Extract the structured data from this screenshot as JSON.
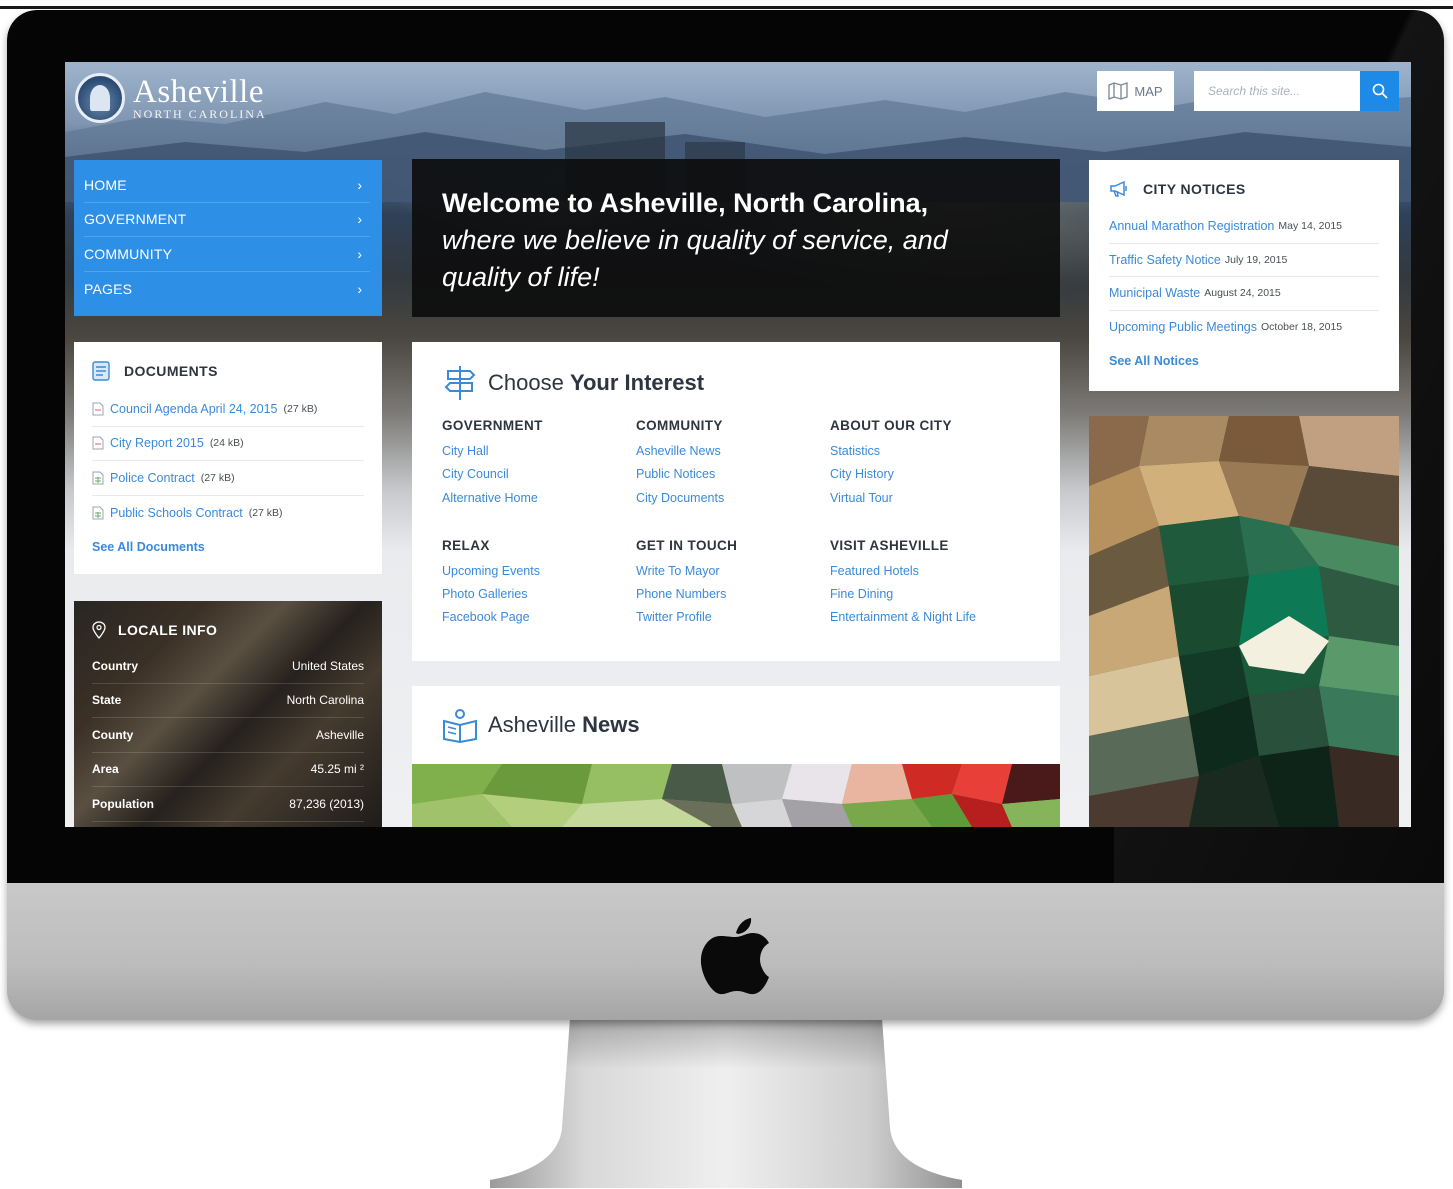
{
  "site": {
    "name": "Asheville",
    "subtitle": "NORTH CAROLINA"
  },
  "header": {
    "map_label": "MAP",
    "search_placeholder": "Search this site..."
  },
  "nav": {
    "items": [
      {
        "label": "HOME"
      },
      {
        "label": "GOVERNMENT"
      },
      {
        "label": "COMMUNITY"
      },
      {
        "label": "PAGES"
      }
    ]
  },
  "documents": {
    "title": "DOCUMENTS",
    "items": [
      {
        "name": "Council Agenda April 24, 2015",
        "size": "(27 kB)",
        "icon": "pdf-file-icon"
      },
      {
        "name": "City Report 2015",
        "size": "(24 kB)",
        "icon": "pdf-file-icon"
      },
      {
        "name": "Police Contract",
        "size": "(27 kB)",
        "icon": "spreadsheet-file-icon"
      },
      {
        "name": "Public Schools Contract",
        "size": "(27 kB)",
        "icon": "spreadsheet-file-icon"
      }
    ],
    "see_all": "See All Documents"
  },
  "locale": {
    "title": "LOCALE INFO",
    "rows": [
      {
        "key": "Country",
        "value": "United States"
      },
      {
        "key": "State",
        "value": "North Carolina"
      },
      {
        "key": "County",
        "value": "Asheville"
      },
      {
        "key": "Area",
        "value": "45.25 mi ²"
      },
      {
        "key": "Population",
        "value": "87,236 (2013)"
      }
    ]
  },
  "welcome": {
    "title": "Welcome to Asheville, North Carolina,",
    "subtitle": "where we believe in quality of service, and quality of life!"
  },
  "interest": {
    "title_light": "Choose ",
    "title_bold": "Your Interest",
    "columns": [
      {
        "title": "GOVERNMENT",
        "links": [
          "City Hall",
          "City Council",
          "Alternative Home"
        ]
      },
      {
        "title": "COMMUNITY",
        "links": [
          "Asheville News",
          "Public Notices",
          "City Documents"
        ]
      },
      {
        "title": "ABOUT OUR CITY",
        "links": [
          "Statistics",
          "City History",
          "Virtual Tour"
        ]
      },
      {
        "title": "RELAX",
        "links": [
          "Upcoming Events",
          "Photo Galleries",
          "Facebook Page"
        ]
      },
      {
        "title": "GET IN TOUCH",
        "links": [
          "Write To Mayor",
          "Phone Numbers",
          "Twitter Profile"
        ]
      },
      {
        "title": "VISIT ASHEVILLE",
        "links": [
          "Featured Hotels",
          "Fine Dining",
          "Entertainment & Night Life"
        ]
      }
    ]
  },
  "news": {
    "title_light": "Asheville ",
    "title_bold": "News"
  },
  "notices": {
    "title": "CITY NOTICES",
    "items": [
      {
        "title": "Annual Marathon Registration",
        "date": "May 14, 2015"
      },
      {
        "title": "Traffic Safety Notice",
        "date": "July 19, 2015"
      },
      {
        "title": "Municipal Waste",
        "date": "August 24, 2015"
      },
      {
        "title": "Upcoming Public Meetings",
        "date": "October 18, 2015"
      }
    ],
    "see_all": "See All Notices"
  },
  "colors": {
    "accent": "#2e8fe6",
    "link": "#3a8ad9",
    "heading": "#2d3540"
  }
}
